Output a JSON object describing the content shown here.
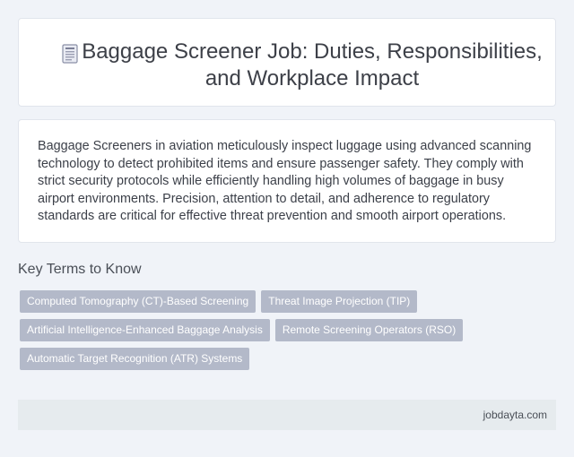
{
  "header": {
    "icon": "document-icon",
    "title": "Baggage Screener Job: Duties, Responsibilities, and Workplace Impact"
  },
  "summary": {
    "text": "Baggage Screeners in aviation meticulously inspect luggage using advanced scanning technology to detect prohibited items and ensure passenger safety. They comply with strict security protocols while efficiently handling high volumes of baggage in busy airport environments. Precision, attention to detail, and adherence to regulatory standards are critical for effective threat prevention and smooth airport operations."
  },
  "key_terms": {
    "heading": "Key Terms to Know",
    "rows": [
      [
        "Computed Tomography (CT)-Based Screening",
        "Threat Image Projection (TIP)"
      ],
      [
        "Artificial Intelligence-Enhanced Baggage Analysis",
        "Remote Screening Operators (RSO)"
      ],
      [
        "Automatic Target Recognition (ATR) Systems"
      ]
    ]
  },
  "footer": {
    "source": "jobdayta.com"
  },
  "colors": {
    "background": "#f0f3f8",
    "tag": "#b3b9c9",
    "footer": "#e6ebee"
  }
}
